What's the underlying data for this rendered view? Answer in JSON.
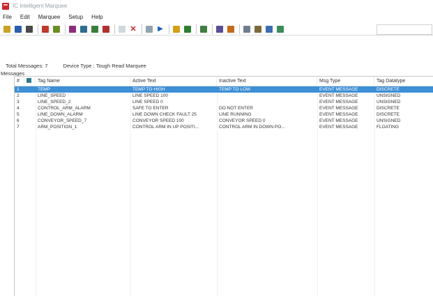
{
  "window": {
    "title": "IC Intelligent Marquee"
  },
  "menu": [
    "File",
    "Edit",
    "Marquee",
    "Setup",
    "Help"
  ],
  "toolbar": {
    "buttons": [
      {
        "name": "open-icon",
        "color": "#c9a227"
      },
      {
        "name": "save-icon",
        "color": "#2a5ea8"
      },
      {
        "name": "print-icon",
        "color": "#4a4a4a"
      },
      {
        "name": "tag-icon",
        "color": "#c0392b"
      },
      {
        "name": "edit-icon",
        "color": "#6b8e23"
      },
      {
        "name": "message-icon",
        "color": "#8e2d7a"
      },
      {
        "name": "display-icon",
        "color": "#2d6e8e"
      },
      {
        "name": "send-icon",
        "color": "#3b7d3b"
      },
      {
        "name": "marquee-icon",
        "color": "#b03030"
      },
      {
        "name": "cut-icon",
        "color": "#cfd8dc"
      },
      {
        "name": "delete-icon",
        "color": "#c62828"
      },
      {
        "name": "find-icon",
        "color": "#90a4ae"
      },
      {
        "name": "pointer-icon",
        "color": "#1a5fb4"
      },
      {
        "name": "clock-icon",
        "color": "#d4a017"
      },
      {
        "name": "settings-icon",
        "color": "#2e7d32"
      },
      {
        "name": "download-icon",
        "color": "#3f7f3f"
      },
      {
        "name": "upload-icon",
        "color": "#5b4c9a"
      },
      {
        "name": "chart-icon",
        "color": "#c56a1c"
      },
      {
        "name": "list-icon",
        "color": "#6d7f8f"
      },
      {
        "name": "grid-icon",
        "color": "#7b6b3b"
      },
      {
        "name": "connect-icon",
        "color": "#3d6db3"
      },
      {
        "name": "help-icon",
        "color": "#3a8d5a"
      }
    ]
  },
  "status": {
    "total_messages": "Total Messages: 7",
    "device_type": "Device Type : Tough Read Marquee"
  },
  "messages_label": "Messages",
  "table": {
    "columns": [
      "#",
      "Tag Name",
      "Active Text",
      "Inactive Text",
      "Msg Type",
      "Tag Datatype"
    ],
    "rows": [
      {
        "num": "1",
        "tag": "TEMP",
        "active": "TEMP TO HIGH",
        "inactive": "TEMP TO LOW",
        "type": "EVENT MESSAGE",
        "datatype": "DISCRETE",
        "selected": true
      },
      {
        "num": "2",
        "tag": "LINE_SPEED",
        "active": "LINE SPEED 100",
        "inactive": "",
        "type": "EVENT MESSAGE",
        "datatype": "UNSIGNED",
        "selected": false
      },
      {
        "num": "3",
        "tag": "LINE_SPEED_2",
        "active": "LINE SPEED 0",
        "inactive": "",
        "type": "EVENT MESSAGE",
        "datatype": "UNSIGNED",
        "selected": false
      },
      {
        "num": "4",
        "tag": "CONTROL_ARM_ALARM",
        "active": "SAFE TO ENTER",
        "inactive": "DO NOT ENTER",
        "type": "EVENT MESSAGE",
        "datatype": "DISCRETE",
        "selected": false
      },
      {
        "num": "5",
        "tag": "LINE_DOWN_ALARM",
        "active": "LINE DOWN CHECK FAULT 25",
        "inactive": "LINE RUNNING",
        "type": "EVENT MESSAGE",
        "datatype": "DISCRETE",
        "selected": false
      },
      {
        "num": "6",
        "tag": "CONVEYOR_SPEED_7",
        "active": "CONVEYOR SPEED 100",
        "inactive": "CONVEYOR SPEED 0",
        "type": "EVENT MESSAGE",
        "datatype": "UNSIGNED",
        "selected": false
      },
      {
        "num": "7",
        "tag": "ARM_POSITION_1",
        "active": "CONTROL ARM IN UP POSITI...",
        "inactive": "CONTROL ARM IN DOWN PO...",
        "type": "EVENT MESSAGE",
        "datatype": "FLOATING",
        "selected": false
      }
    ]
  },
  "colors": {
    "selection": "#3d8fd6",
    "accent": "#c8282d"
  }
}
